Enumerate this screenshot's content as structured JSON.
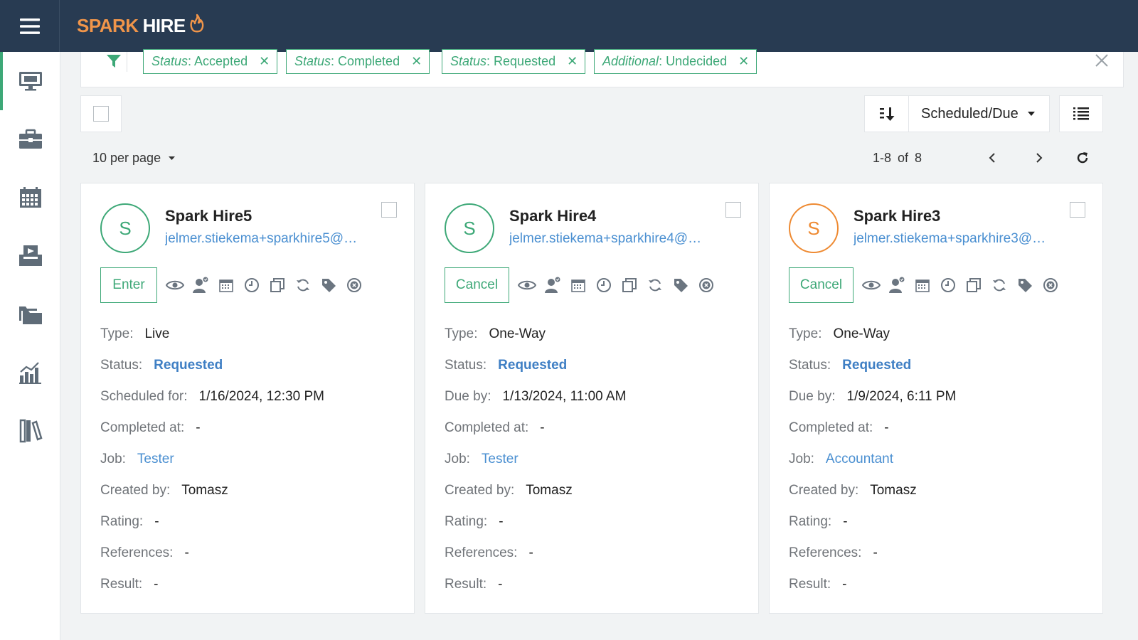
{
  "app": {
    "logo_part1": "SPARK",
    "logo_part2": "HIRE",
    "colors": {
      "topbar": "#283b52",
      "accent_green": "#3da877",
      "accent_orange": "#ee8a32",
      "link_blue": "#4a8fd1",
      "status_blue": "#3f7fc4"
    }
  },
  "sidebar": {
    "items": [
      {
        "icon": "monitor-icon",
        "active": true
      },
      {
        "icon": "briefcase-icon",
        "active": false
      },
      {
        "icon": "calendar-icon",
        "active": false
      },
      {
        "icon": "inbox-icon",
        "active": false
      },
      {
        "icon": "folders-icon",
        "active": false
      },
      {
        "icon": "analytics-icon",
        "active": false
      },
      {
        "icon": "library-icon",
        "active": false
      }
    ]
  },
  "filters": {
    "chips": [
      {
        "key": "Status",
        "value": ": Accepted"
      },
      {
        "key": "Status",
        "value": ": Completed"
      },
      {
        "key": "Status",
        "value": ": Requested"
      },
      {
        "key": "Additional",
        "value": ": Undecided"
      }
    ],
    "remove_glyph": "✕"
  },
  "toolbar": {
    "sort_field": "Scheduled/Due",
    "per_page": "10 per page",
    "page_info": "1-8  of  8"
  },
  "cards": [
    {
      "initial": "S",
      "avatar_color": "green",
      "name": "Spark Hire5",
      "email": "jelmer.stiekema+sparkhire5@…",
      "action": "Enter",
      "type_label": "Type:",
      "type": "Live",
      "status_label": "Status:",
      "status": "Requested",
      "date_label": "Scheduled for:",
      "date": "1/16/2024, 12:30 PM",
      "completed_label": "Completed at:",
      "completed": "-",
      "job_label": "Job:",
      "job": "Tester",
      "created_label": "Created by:",
      "created": "Tomasz",
      "rating_label": "Rating:",
      "rating": "-",
      "references_label": "References:",
      "references": "-",
      "result_label": "Result:",
      "result": "-"
    },
    {
      "initial": "S",
      "avatar_color": "green",
      "name": "Spark Hire4",
      "email": "jelmer.stiekema+sparkhire4@…",
      "action": "Cancel",
      "type_label": "Type:",
      "type": "One-Way",
      "status_label": "Status:",
      "status": "Requested",
      "date_label": "Due by:",
      "date": "1/13/2024, 11:00 AM",
      "completed_label": "Completed at:",
      "completed": "-",
      "job_label": "Job:",
      "job": "Tester",
      "created_label": "Created by:",
      "created": "Tomasz",
      "rating_label": "Rating:",
      "rating": "-",
      "references_label": "References:",
      "references": "-",
      "result_label": "Result:",
      "result": "-"
    },
    {
      "initial": "S",
      "avatar_color": "orange",
      "name": "Spark Hire3",
      "email": "jelmer.stiekema+sparkhire3@…",
      "action": "Cancel",
      "type_label": "Type:",
      "type": "One-Way",
      "status_label": "Status:",
      "status": "Requested",
      "date_label": "Due by:",
      "date": "1/9/2024, 6:11 PM",
      "completed_label": "Completed at:",
      "completed": "-",
      "job_label": "Job:",
      "job": "Accountant",
      "created_label": "Created by:",
      "created": "Tomasz",
      "rating_label": "Rating:",
      "rating": "-",
      "references_label": "References:",
      "references": "-",
      "result_label": "Result:",
      "result": "-"
    }
  ]
}
